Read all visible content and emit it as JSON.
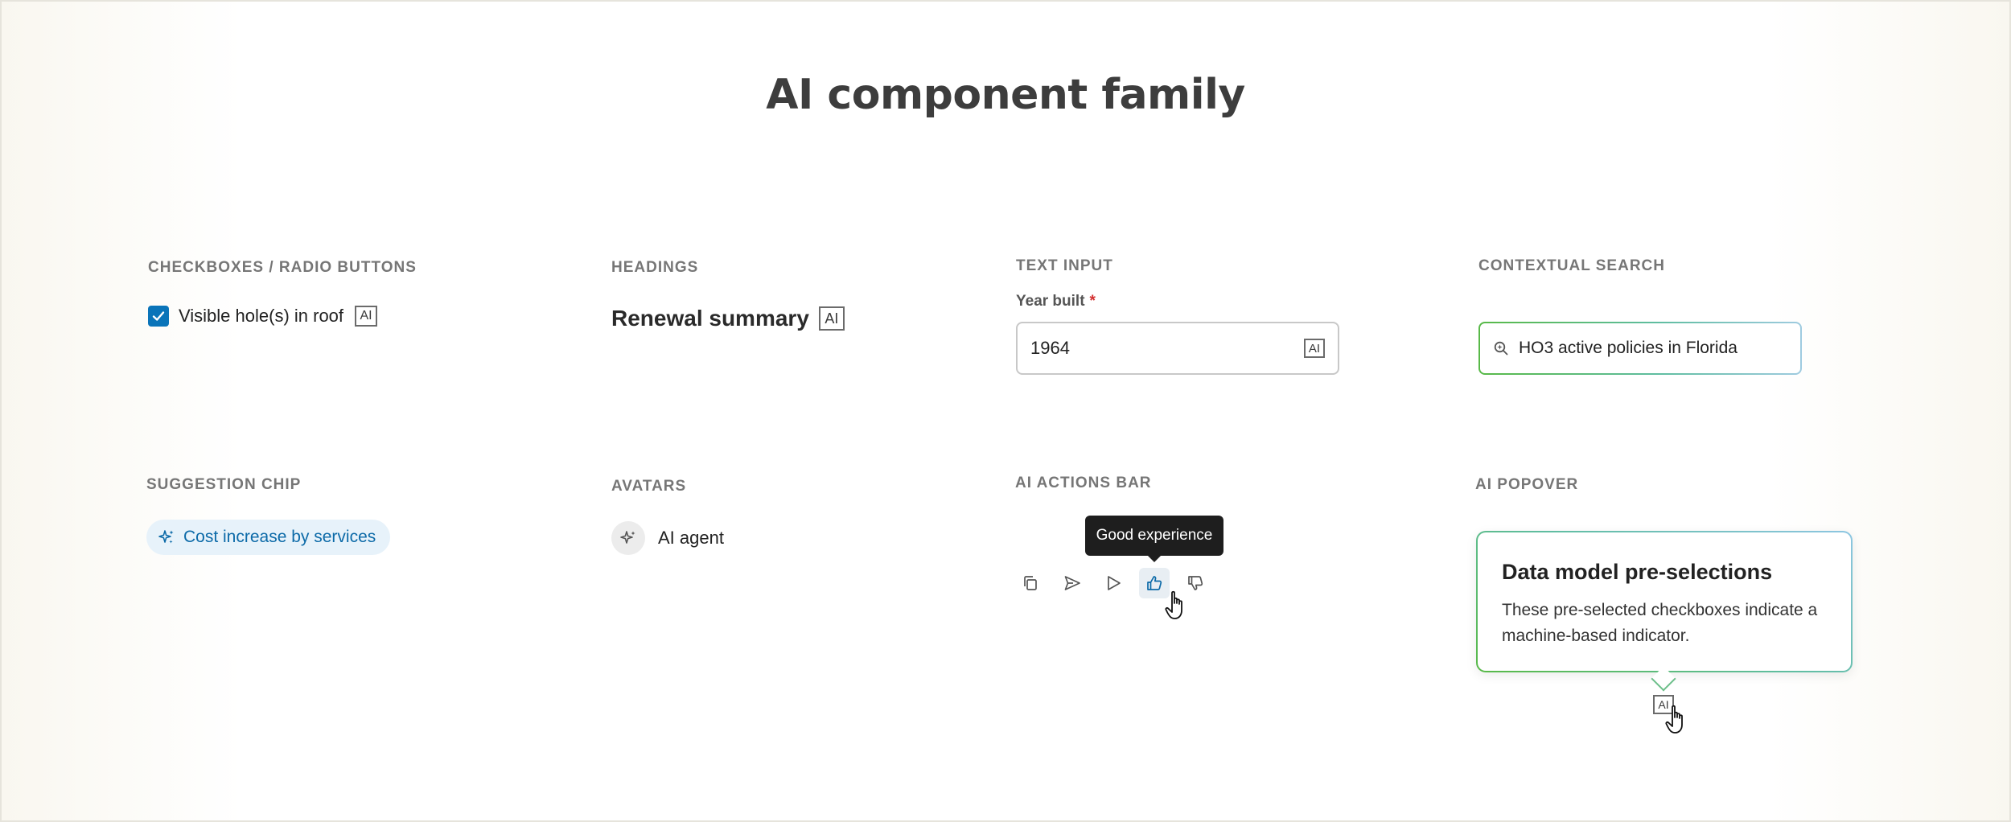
{
  "page": {
    "title": "AI component family"
  },
  "sections": {
    "checkboxes": {
      "label": "CHECKBOXES / RADIO BUTTONS",
      "item_label": "Visible hole(s) in roof",
      "checked": true,
      "badge": "AI",
      "accent": "#0a74b9"
    },
    "headings": {
      "label": "HEADINGS",
      "heading_text": "Renewal summary",
      "badge": "AI"
    },
    "text_input": {
      "label": "TEXT INPUT",
      "field_label": "Year built",
      "required_marker": "*",
      "value": "1964",
      "badge": "AI"
    },
    "contextual_search": {
      "label": "CONTEXTUAL SEARCH",
      "value": "HO3 active policies in Florida",
      "icon": "ai-search-icon"
    },
    "suggestion_chip": {
      "label": "SUGGESTION CHIP",
      "chip_text": "Cost increase by services",
      "icon": "sparkle-icon",
      "accent": "#0c6aa8"
    },
    "avatars": {
      "label": "AVATARS",
      "avatar_name": "AI agent",
      "icon": "sparkle-icon"
    },
    "actions_bar": {
      "label": "AI ACTIONS BAR",
      "tooltip": "Good experience",
      "actions": [
        "copy-icon",
        "send-icon",
        "play-icon",
        "thumbs-up-icon",
        "thumbs-down-icon"
      ],
      "active_action": "thumbs-up-icon"
    },
    "popover": {
      "label": "AI POPOVER",
      "title": "Data model pre-selections",
      "body": "These pre-selected checkboxes indicate a machine-based indicator.",
      "badge": "AI"
    }
  }
}
